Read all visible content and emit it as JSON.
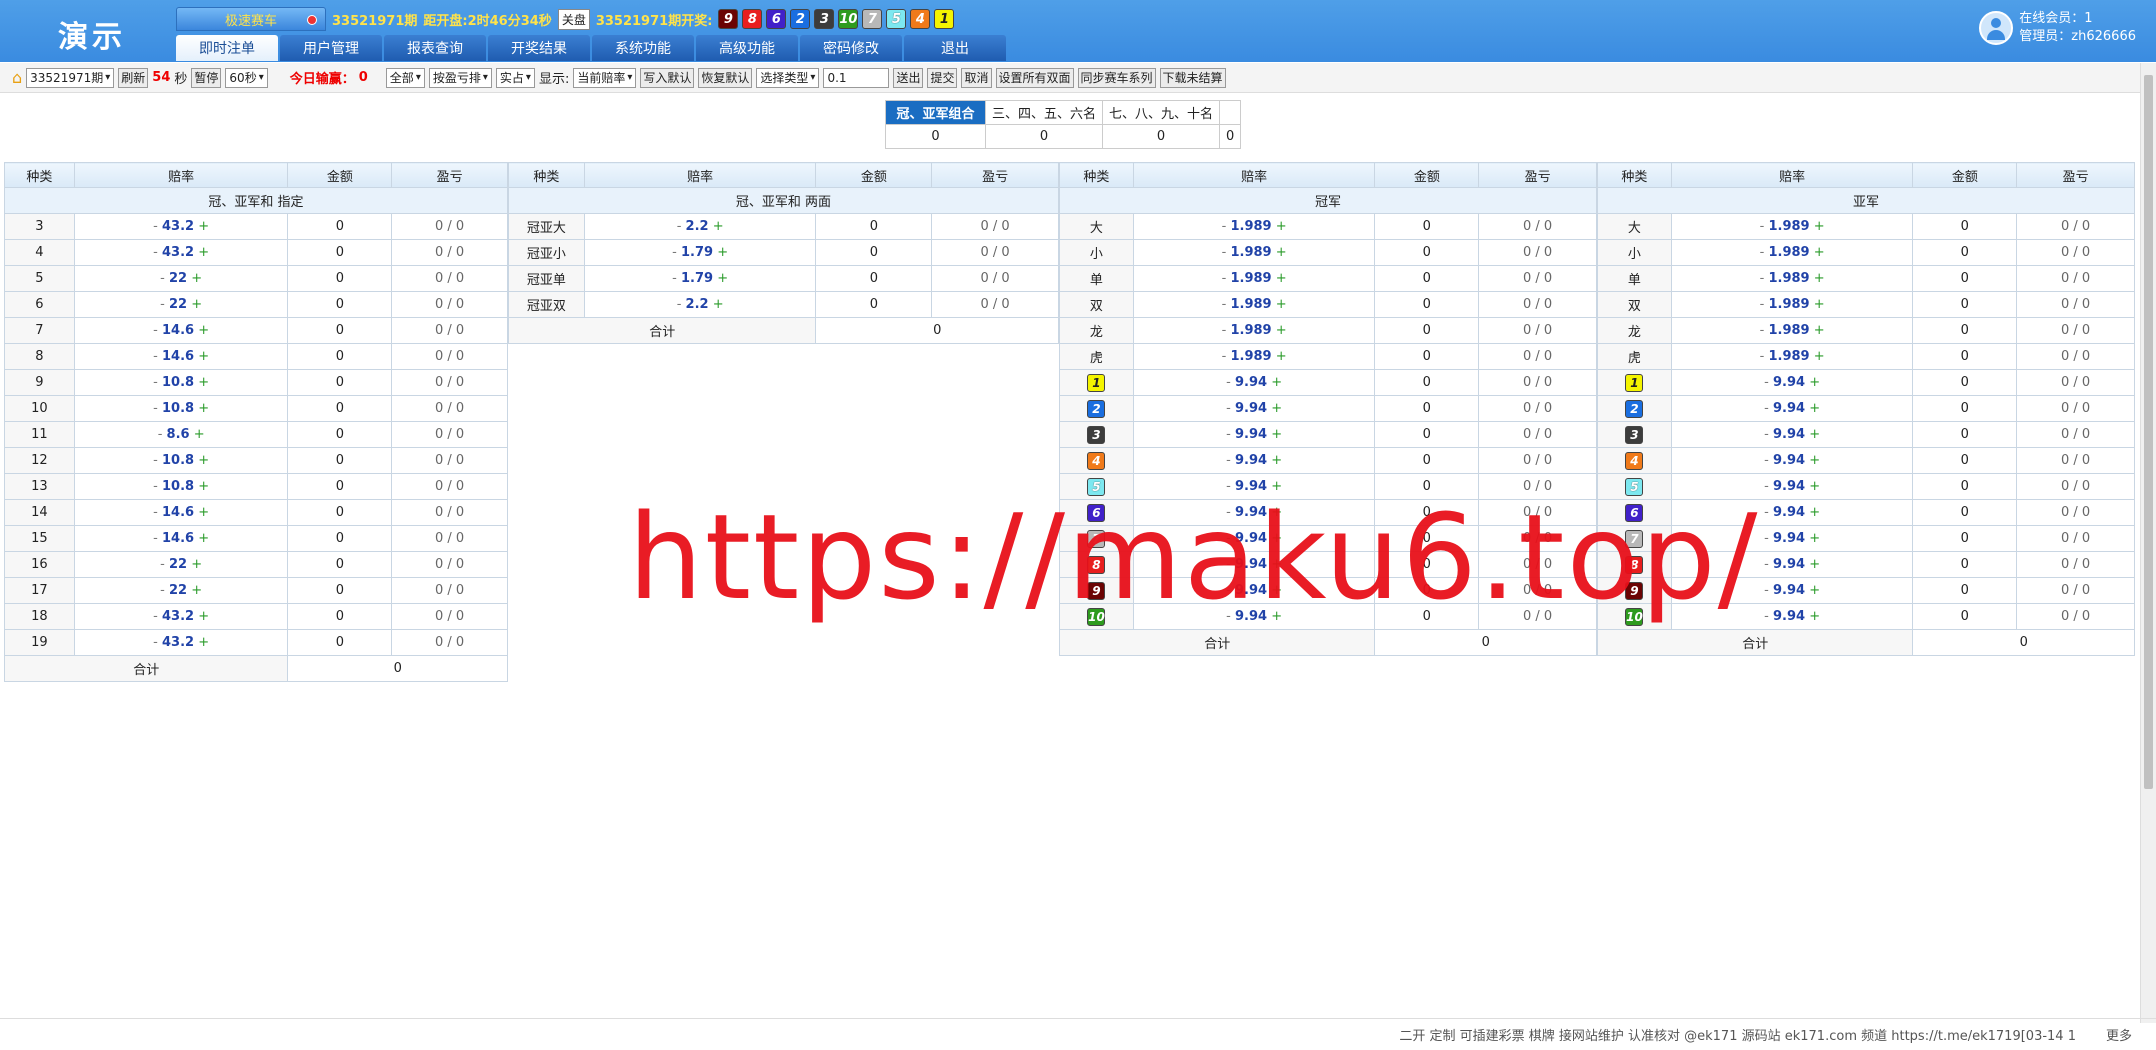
{
  "header": {
    "logo": "演示",
    "game_tab": "极速赛车",
    "issue": "33521971期",
    "countdown": "距开盘:2时46分34秒",
    "close_label": "关盘",
    "last_issue": "33521971期开奖:",
    "last_balls": [
      "9",
      "8",
      "6",
      "2",
      "3",
      "10",
      "7",
      "5",
      "4",
      "1"
    ],
    "nav": [
      "即时注单",
      "用户管理",
      "报表查询",
      "开奖结果",
      "系统功能",
      "高级功能",
      "密码修改",
      "退出"
    ],
    "online_label": "在线会员：1",
    "admin_label": "管理员：zh626666"
  },
  "toolbar": {
    "issue_select": "33521971期",
    "refresh": "刷新",
    "sec_value": "54",
    "sec_unit": "秒",
    "pause": "暂停",
    "interval": "60秒",
    "today_label": "今日输赢：",
    "today_value": "0",
    "filter_all": "全部",
    "sort": "按盈亏排",
    "mode": "实占",
    "display_label": "显示:",
    "odds_mode": "当前赔率",
    "write_default": "写入默认",
    "restore_default": "恢复默认",
    "type_select": "选择类型",
    "step_value": "0.1",
    "send": "送出",
    "submit": "提交",
    "cancel": "取消",
    "set_all": "设置所有双面",
    "sync": "同步赛车系列",
    "download": "下载未结算"
  },
  "categories": [
    {
      "label": "冠、亚军组合",
      "value": "0"
    },
    {
      "label": "三、四、五、六名",
      "value": "0"
    },
    {
      "label": "七、八、九、十名",
      "value": "0"
    },
    {
      "label": "",
      "value": "0"
    }
  ],
  "cols": {
    "kind": "种类",
    "odds": "赔率",
    "amount": "金额",
    "pl": "盈亏",
    "total": "合计"
  },
  "t1": {
    "title": "冠、亚军和 指定",
    "rows": [
      [
        "3",
        "43.2"
      ],
      [
        "4",
        "43.2"
      ],
      [
        "5",
        "22"
      ],
      [
        "6",
        "22"
      ],
      [
        "7",
        "14.6"
      ],
      [
        "8",
        "14.6"
      ],
      [
        "9",
        "10.8"
      ],
      [
        "10",
        "10.8"
      ],
      [
        "11",
        "8.6"
      ],
      [
        "12",
        "10.8"
      ],
      [
        "13",
        "10.8"
      ],
      [
        "14",
        "14.6"
      ],
      [
        "15",
        "14.6"
      ],
      [
        "16",
        "22"
      ],
      [
        "17",
        "22"
      ],
      [
        "18",
        "43.2"
      ],
      [
        "19",
        "43.2"
      ]
    ],
    "total": "0"
  },
  "t2": {
    "title": "冠、亚军和 两面",
    "rows": [
      [
        "冠亚大",
        "2.2"
      ],
      [
        "冠亚小",
        "1.79"
      ],
      [
        "冠亚单",
        "1.79"
      ],
      [
        "冠亚双",
        "2.2"
      ]
    ],
    "total": "0"
  },
  "t3": {
    "title": "冠军",
    "rows": [
      [
        "大",
        "1.989"
      ],
      [
        "小",
        "1.989"
      ],
      [
        "单",
        "1.989"
      ],
      [
        "双",
        "1.989"
      ],
      [
        "龙",
        "1.989"
      ],
      [
        "虎",
        "1.989"
      ],
      [
        "1",
        "9.94"
      ],
      [
        "2",
        "9.94"
      ],
      [
        "3",
        "9.94"
      ],
      [
        "4",
        "9.94"
      ],
      [
        "5",
        "9.94"
      ],
      [
        "6",
        "9.94"
      ],
      [
        "7",
        "9.94"
      ],
      [
        "8",
        "9.94"
      ],
      [
        "9",
        "9.94"
      ],
      [
        "10",
        "9.94"
      ]
    ],
    "total": "0"
  },
  "t4": {
    "title": "亚军",
    "rows": [
      [
        "大",
        "1.989"
      ],
      [
        "小",
        "1.989"
      ],
      [
        "单",
        "1.989"
      ],
      [
        "双",
        "1.989"
      ],
      [
        "龙",
        "1.989"
      ],
      [
        "虎",
        "1.989"
      ],
      [
        "1",
        "9.94"
      ],
      [
        "2",
        "9.94"
      ],
      [
        "3",
        "9.94"
      ],
      [
        "4",
        "9.94"
      ],
      [
        "5",
        "9.94"
      ],
      [
        "6",
        "9.94"
      ],
      [
        "7",
        "9.94"
      ],
      [
        "8",
        "9.94"
      ],
      [
        "9",
        "9.94"
      ],
      [
        "10",
        "9.94"
      ]
    ],
    "total": "0"
  },
  "cell": {
    "minus": "-",
    "plus": "+",
    "amount": "0",
    "pl": "0 / 0"
  },
  "footer": {
    "text": "二开 定制 可插建彩票 棋牌 接网站维护 认准核对 @ek171 源码站 ek171.com 频道 https://t.me/ek1719[03-14 1",
    "more": "更多"
  },
  "watermark": "https://maku6.top/"
}
